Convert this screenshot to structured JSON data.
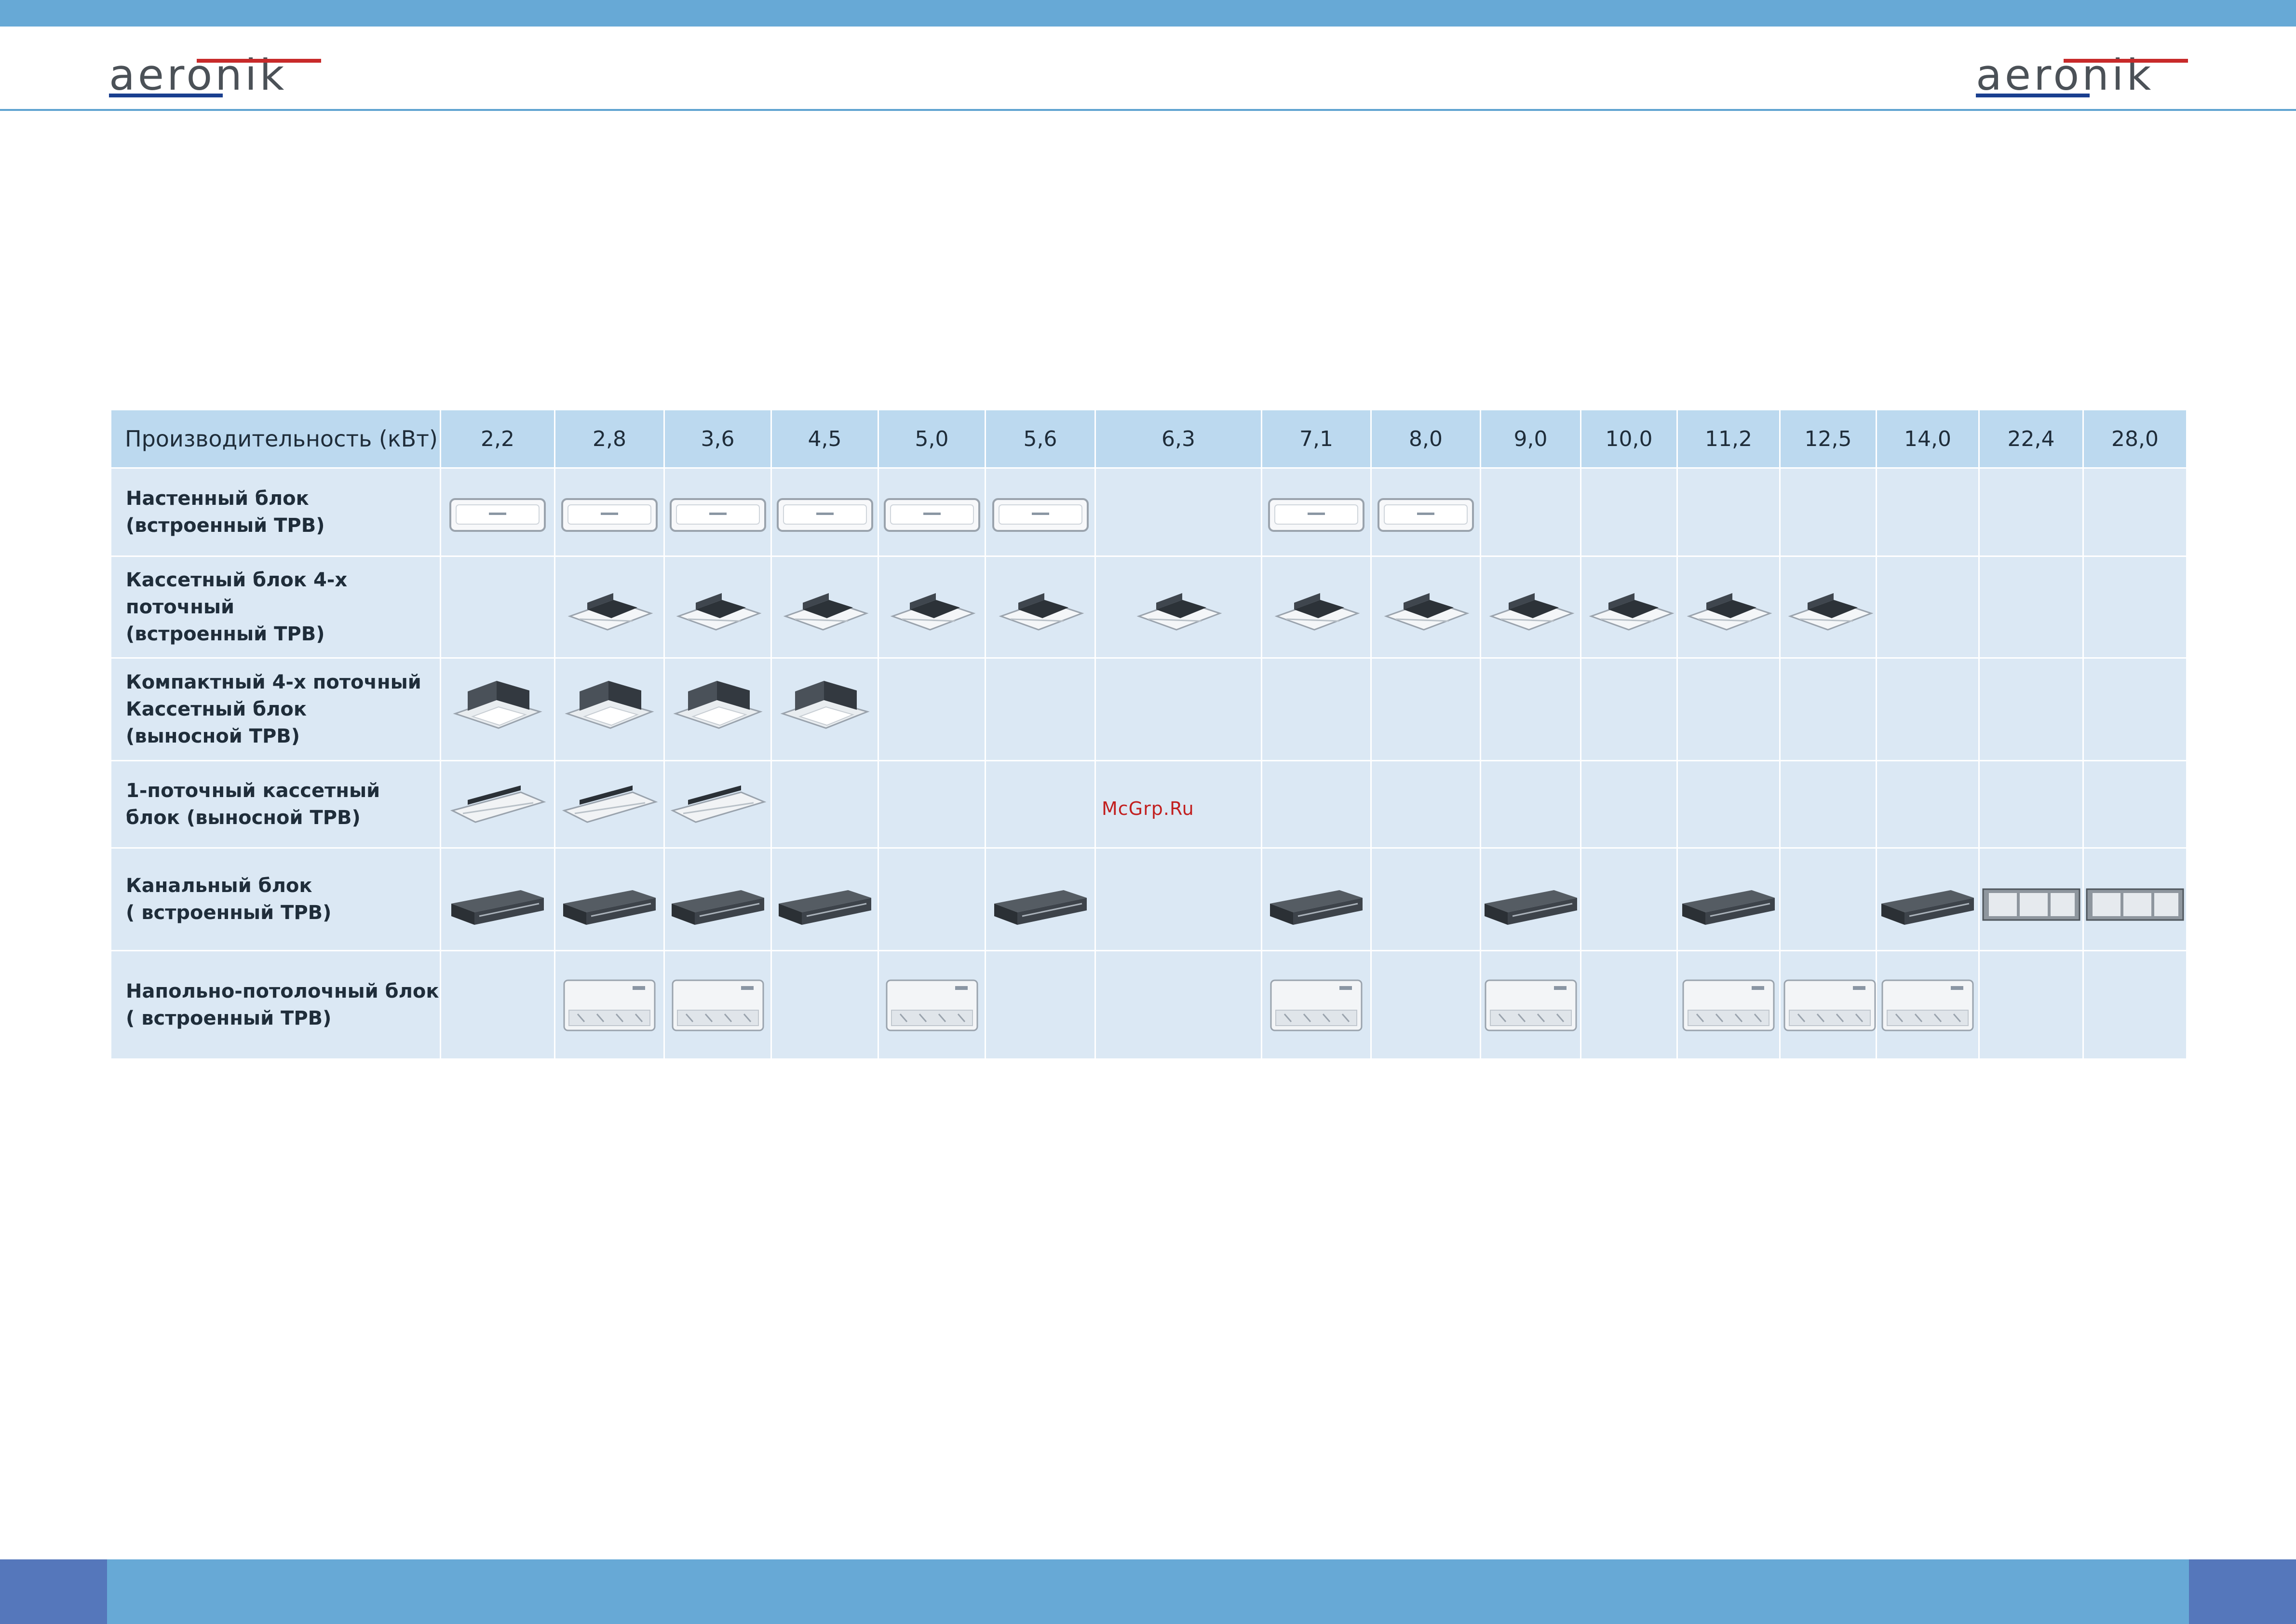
{
  "brand": {
    "logo_text": "aeronik"
  },
  "watermark": "McGrp.Ru",
  "table": {
    "header_label": "Производительность (кВт)",
    "capacities": [
      "2,2",
      "2,8",
      "3,6",
      "4,5",
      "5,0",
      "5,6",
      "6,3",
      "7,1",
      "8,0",
      "9,0",
      "10,0",
      "11,2",
      "12,5",
      "14,0",
      "22,4",
      "28,0"
    ],
    "rows": [
      {
        "label": "Настенный блок\n(встроенный ТРВ)",
        "unit": "wall-unit",
        "available": [
          1,
          1,
          1,
          1,
          1,
          1,
          0,
          1,
          1,
          0,
          0,
          0,
          0,
          0,
          0,
          0
        ]
      },
      {
        "label": "Кассетный блок 4-х поточный\n(встроенный ТРВ)",
        "unit": "cassette-4way",
        "available": [
          0,
          1,
          1,
          1,
          1,
          1,
          1,
          1,
          1,
          1,
          1,
          1,
          1,
          0,
          0,
          0
        ]
      },
      {
        "label": "Компактный 4-х поточный\nКассетный блок\n(выносной ТРВ)",
        "unit": "compact-cassette",
        "available": [
          1,
          1,
          1,
          1,
          0,
          0,
          0,
          0,
          0,
          0,
          0,
          0,
          0,
          0,
          0,
          0
        ]
      },
      {
        "label": "1-поточный кассетный\nблок  (выносной ТРВ)",
        "unit": "cassette-1way",
        "available": [
          1,
          1,
          1,
          0,
          0,
          0,
          0,
          0,
          0,
          0,
          0,
          0,
          0,
          0,
          0,
          0
        ]
      },
      {
        "label": "Канальный блок\n( встроенный ТРВ)",
        "unit": "duct-unit",
        "available": [
          1,
          1,
          1,
          1,
          0,
          1,
          0,
          1,
          0,
          1,
          0,
          1,
          0,
          1,
          2,
          2
        ]
      },
      {
        "label": "Напольно-потолочный блок\n( встроенный ТРВ)",
        "unit": "floor-ceiling-unit",
        "available": [
          0,
          1,
          1,
          0,
          1,
          0,
          0,
          1,
          0,
          1,
          0,
          1,
          1,
          1,
          0,
          0
        ]
      }
    ]
  },
  "colors": {
    "band": "#67a9d6",
    "band_dark": "#5577bb",
    "header_row": "#bcd9ef",
    "body_row": "#dbe8f4",
    "logo_red": "#c82a2a",
    "logo_blue": "#1a3f8f"
  }
}
